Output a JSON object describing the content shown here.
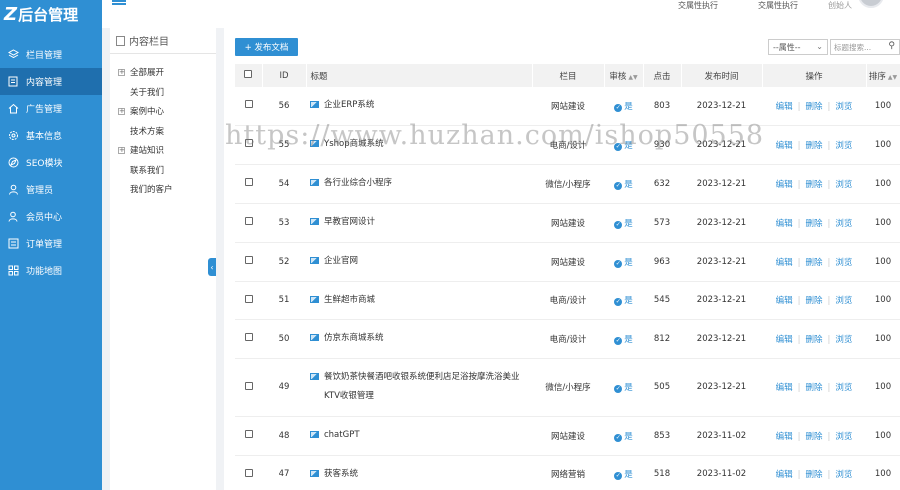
{
  "app": {
    "logo_text": "后台管理",
    "logo_mark": "Z"
  },
  "header": {
    "item_a": "交属性执行",
    "item_b": "交属性执行",
    "user_role": "创始人"
  },
  "sidebar": {
    "items": [
      {
        "label": "栏目管理",
        "icon": "layers-icon"
      },
      {
        "label": "内容管理",
        "icon": "document-icon",
        "active": true
      },
      {
        "label": "广告管理",
        "icon": "home-icon"
      },
      {
        "label": "基本信息",
        "icon": "gear-icon"
      },
      {
        "label": "SEO模块",
        "icon": "compass-icon"
      },
      {
        "label": "管理员",
        "icon": "user-icon"
      },
      {
        "label": "会员中心",
        "icon": "member-icon"
      },
      {
        "label": "订单管理",
        "icon": "list-icon"
      },
      {
        "label": "功能地图",
        "icon": "grid-icon"
      }
    ]
  },
  "content_tree": {
    "title": "内容栏目",
    "items": [
      {
        "label": "全部展开",
        "expandable": true
      },
      {
        "label": "关于我们",
        "expandable": false
      },
      {
        "label": "案例中心",
        "expandable": true
      },
      {
        "label": "技术方案",
        "expandable": false,
        "indent": true
      },
      {
        "label": "建站知识",
        "expandable": true
      },
      {
        "label": "联系我们",
        "expandable": false
      },
      {
        "label": "我们的客户",
        "expandable": false
      }
    ]
  },
  "toolbar": {
    "publish_label": "+ 发布文档",
    "attr_select_value": "--属性--",
    "search_placeholder": "标题搜索..."
  },
  "table": {
    "headers": {
      "id": "ID",
      "title": "标题",
      "column": "栏目",
      "review": "审核",
      "clicks": "点击",
      "date": "发布时间",
      "actions": "操作",
      "sort": "排序"
    },
    "action_labels": {
      "edit": "编辑",
      "delete": "删除",
      "view": "浏览"
    },
    "rows": [
      {
        "id": "56",
        "title": "企业ERP系统",
        "column": "网站建设",
        "review": "是",
        "clicks": "803",
        "date": "2023-12-21",
        "sort": "100"
      },
      {
        "id": "55",
        "title": "Yshop商城系统",
        "column": "电商/设计",
        "review": "是",
        "clicks": "930",
        "date": "2023-12-21",
        "sort": "100"
      },
      {
        "id": "54",
        "title": "各行业综合小程序",
        "column": "微信/小程序",
        "review": "是",
        "clicks": "632",
        "date": "2023-12-21",
        "sort": "100"
      },
      {
        "id": "53",
        "title": "早教官网设计",
        "column": "网站建设",
        "review": "是",
        "clicks": "573",
        "date": "2023-12-21",
        "sort": "100"
      },
      {
        "id": "52",
        "title": "企业官网",
        "column": "网站建设",
        "review": "是",
        "clicks": "963",
        "date": "2023-12-21",
        "sort": "100"
      },
      {
        "id": "51",
        "title": "生鲜超市商城",
        "column": "电商/设计",
        "review": "是",
        "clicks": "545",
        "date": "2023-12-21",
        "sort": "100"
      },
      {
        "id": "50",
        "title": "仿京东商城系统",
        "column": "电商/设计",
        "review": "是",
        "clicks": "812",
        "date": "2023-12-21",
        "sort": "100"
      },
      {
        "id": "49",
        "title": "餐饮奶茶快餐酒吧收银系统便利店足浴按摩洗浴美业KTV收银管理",
        "column": "微信/小程序",
        "review": "是",
        "clicks": "505",
        "date": "2023-12-21",
        "sort": "100"
      },
      {
        "id": "48",
        "title": "chatGPT",
        "column": "网站建设",
        "review": "是",
        "clicks": "853",
        "date": "2023-11-02",
        "sort": "100"
      },
      {
        "id": "47",
        "title": "获客系统",
        "column": "网络营销",
        "review": "是",
        "clicks": "518",
        "date": "2023-11-02",
        "sort": "100"
      }
    ]
  },
  "watermark": "https://www.huzhan.com/ishop50558",
  "colors": {
    "accent": "#2f8fd3",
    "sidebar_active": "#1f6fae",
    "header_bg": "#f2f2f2"
  }
}
